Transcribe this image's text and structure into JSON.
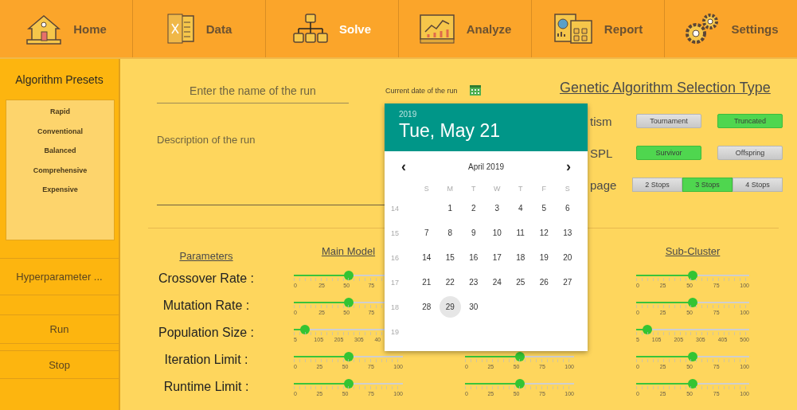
{
  "nav": {
    "tabs": [
      {
        "label": "Home",
        "selected": false
      },
      {
        "label": "Data",
        "selected": false
      },
      {
        "label": "Solve",
        "selected": true
      },
      {
        "label": "Analyze",
        "selected": false
      },
      {
        "label": "Report",
        "selected": false
      },
      {
        "label": "Settings",
        "selected": false
      }
    ]
  },
  "sidebar": {
    "presets_title": "Algorithm Presets",
    "presets": [
      "Rapid",
      "Conventional",
      "Balanced",
      "Comprehensive",
      "Expensive"
    ],
    "buttons": [
      "Hyperparameter ...",
      "Run",
      "Stop"
    ]
  },
  "run": {
    "name_placeholder": "Enter the name of the run",
    "description_placeholder": "Description of the run",
    "date_label": "Current date of the run"
  },
  "selection": {
    "title": "Genetic Algorithm Selection Type",
    "rows": [
      {
        "label": "tism",
        "kind": "pair",
        "options": [
          {
            "label": "Tournament",
            "selected": false
          },
          {
            "label": "Truncated",
            "selected": true
          }
        ]
      },
      {
        "label": "SPL",
        "kind": "pair",
        "options": [
          {
            "label": "Survivor",
            "selected": true
          },
          {
            "label": "Offspring",
            "selected": false
          }
        ]
      },
      {
        "label": "page",
        "kind": "segmented",
        "options": [
          {
            "label": "2 Stops",
            "selected": false
          },
          {
            "label": "3 Stops",
            "selected": true
          },
          {
            "label": "4 Stops",
            "selected": false
          }
        ]
      }
    ]
  },
  "parameters": {
    "heading": "Parameters",
    "labels": [
      "Crossover Rate :",
      "Mutation Rate :",
      "Population Size :",
      "Iteration Limit :",
      "Runtime Limit :"
    ],
    "columns": [
      {
        "heading": "Main Model",
        "sliders": [
          {
            "level": 0.5,
            "covered": true,
            "ticks": [
              "0",
              "25",
              "50",
              "75"
            ]
          },
          {
            "level": 0.5,
            "covered": true,
            "ticks": [
              "0",
              "25",
              "50",
              "75"
            ]
          },
          {
            "level": 0.1,
            "covered": true,
            "ticks": [
              "5",
              "105",
              "205",
              "305",
              "40"
            ]
          },
          {
            "level": 0.5,
            "covered": false,
            "ticks": [
              "0",
              "25",
              "50",
              "75",
              "100"
            ]
          },
          {
            "level": 0.5,
            "covered": false,
            "ticks": [
              "0",
              "25",
              "50",
              "75",
              "100"
            ]
          }
        ]
      },
      {
        "sliders": [
          {
            "level": 0.5,
            "covered": false,
            "ticks": [
              "0",
              "25",
              "50",
              "75",
              "100"
            ]
          },
          {
            "level": 0.5,
            "covered": false,
            "ticks": [
              "0",
              "25",
              "50",
              "75",
              "100"
            ]
          }
        ]
      },
      {
        "heading": "Sub-Cluster",
        "sliders": [
          {
            "level": 0.5,
            "covered": false,
            "ticks": [
              "0",
              "25",
              "50",
              "75",
              "100"
            ]
          },
          {
            "level": 0.5,
            "covered": false,
            "ticks": [
              "0",
              "25",
              "50",
              "75",
              "100"
            ]
          },
          {
            "level": 0.1,
            "covered": false,
            "ticks": [
              "5",
              "105",
              "205",
              "305",
              "405",
              "500"
            ]
          },
          {
            "level": 0.5,
            "covered": false,
            "ticks": [
              "0",
              "25",
              "50",
              "75",
              "100"
            ]
          },
          {
            "level": 0.5,
            "covered": false,
            "ticks": [
              "0",
              "25",
              "50",
              "75",
              "100"
            ]
          }
        ]
      }
    ]
  },
  "date_picker": {
    "year": "2019",
    "date": "Tue, May 21",
    "month": "April 2019",
    "prev": "‹",
    "next": "›",
    "weekdays": [
      "S",
      "M",
      "T",
      "W",
      "T",
      "F",
      "S"
    ],
    "weeks": [
      {
        "number": "14",
        "days": [
          {
            "label": "1",
            "selected": false
          },
          {
            "label": "2",
            "selected": false
          },
          {
            "label": "3",
            "selected": false
          },
          {
            "label": "4",
            "selected": false
          },
          {
            "label": "5",
            "selected": false
          },
          {
            "label": "6",
            "selected": false
          }
        ]
      },
      {
        "number": "15",
        "days": [
          {
            "label": "7",
            "selected": false
          },
          {
            "label": "8",
            "selected": false
          },
          {
            "label": "9",
            "selected": false
          },
          {
            "label": "10",
            "selected": false
          },
          {
            "label": "11",
            "selected": false
          },
          {
            "label": "12",
            "selected": false
          },
          {
            "label": "13",
            "selected": false
          }
        ]
      },
      {
        "number": "16",
        "days": [
          {
            "label": "14",
            "selected": false
          },
          {
            "label": "15",
            "selected": false
          },
          {
            "label": "16",
            "selected": false
          },
          {
            "label": "17",
            "selected": false
          },
          {
            "label": "18",
            "selected": false
          },
          {
            "label": "19",
            "selected": false
          },
          {
            "label": "20",
            "selected": false
          }
        ]
      },
      {
        "number": "17",
        "days": [
          {
            "label": "21",
            "selected": false
          },
          {
            "label": "22",
            "selected": false
          },
          {
            "label": "23",
            "selected": false
          },
          {
            "label": "24",
            "selected": false
          },
          {
            "label": "25",
            "selected": false
          },
          {
            "label": "26",
            "selected": false
          },
          {
            "label": "27",
            "selected": false
          }
        ]
      },
      {
        "number": "18",
        "days": [
          {
            "label": "28",
            "selected": false
          },
          {
            "label": "29",
            "selected": true
          },
          {
            "label": "30",
            "selected": false
          }
        ]
      },
      {
        "number": "19"
      }
    ]
  }
}
